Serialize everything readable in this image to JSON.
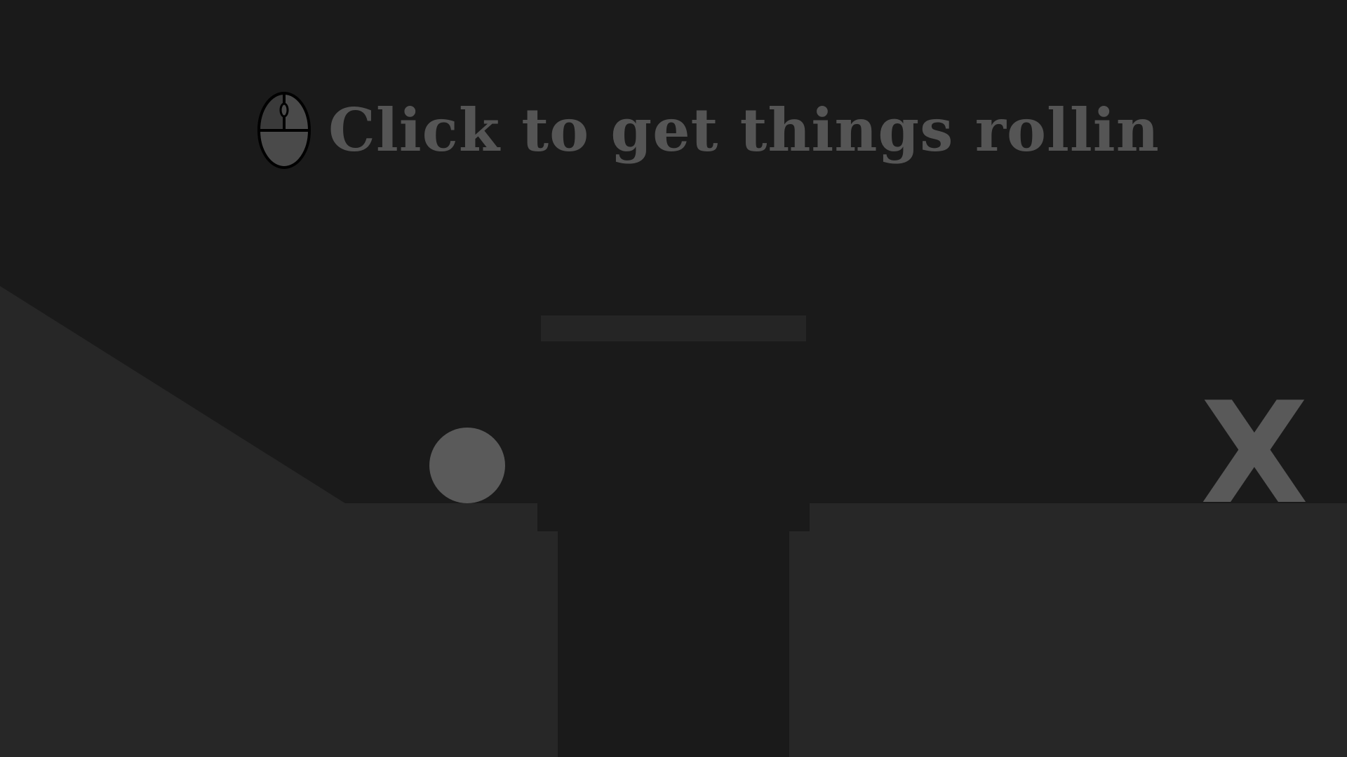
{
  "instruction": {
    "text": "Click to get things rollin",
    "icon": "mouse-left-click-icon"
  },
  "goal": {
    "label": "X"
  },
  "colors": {
    "background": "#1a1a1a",
    "terrain": "#272727",
    "floating_platform": "#252525",
    "ball": "#5a5a5a",
    "text": "#555555",
    "goal": "#595959",
    "icon_fill": "#4a4a4a",
    "icon_stroke": "#000000"
  }
}
